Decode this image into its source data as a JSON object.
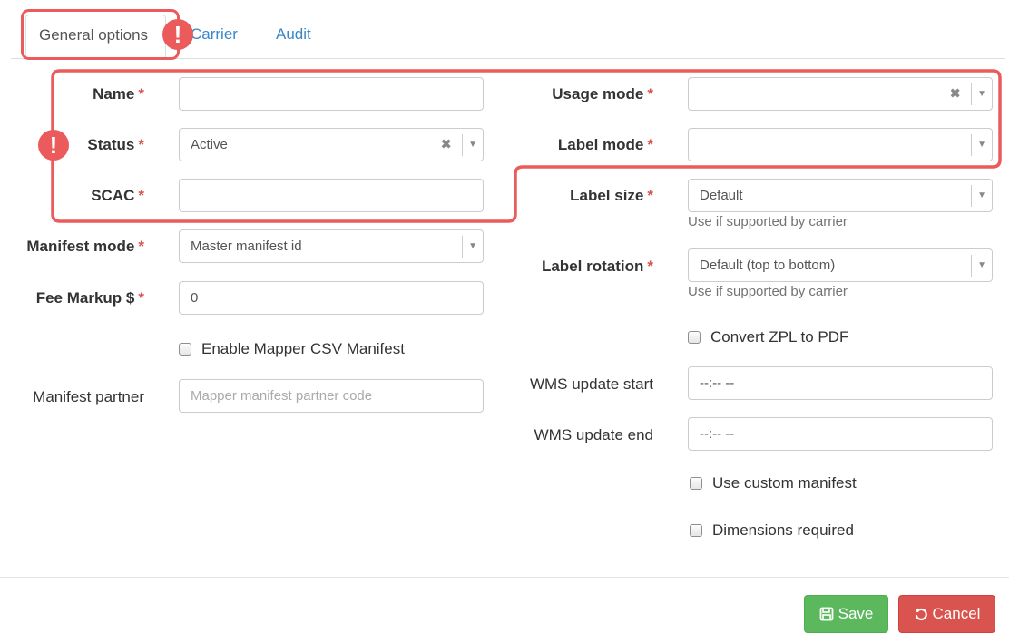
{
  "tabs": {
    "general": "General options",
    "carrier": "Carrier",
    "audit": "Audit"
  },
  "warning_mark": "!",
  "required_mark": "*",
  "left": {
    "name": {
      "label": "Name",
      "value": ""
    },
    "status": {
      "label": "Status",
      "value": "Active"
    },
    "scac": {
      "label": "SCAC",
      "value": ""
    },
    "manifest_mode": {
      "label": "Manifest mode",
      "value": "Master manifest id"
    },
    "fee_markup": {
      "label": "Fee Markup $",
      "value": "0"
    },
    "enable_mapper_csv": {
      "label": "Enable Mapper CSV Manifest",
      "checked": false
    },
    "manifest_partner": {
      "label": "Manifest partner",
      "value": "",
      "placeholder": "Mapper manifest partner code"
    }
  },
  "right": {
    "usage_mode": {
      "label": "Usage mode",
      "value": ""
    },
    "label_mode": {
      "label": "Label mode",
      "value": ""
    },
    "label_size": {
      "label": "Label size",
      "value": "Default",
      "help": "Use if supported by carrier"
    },
    "label_rotation": {
      "label": "Label rotation",
      "value": "Default (top to bottom)",
      "help": "Use if supported by carrier"
    },
    "convert_zpl": {
      "label": "Convert ZPL to PDF",
      "checked": false
    },
    "wms_start": {
      "label": "WMS update start",
      "value": "--:-- --"
    },
    "wms_end": {
      "label": "WMS update end",
      "value": "--:-- --"
    },
    "custom_manifest": {
      "label": "Use custom manifest",
      "checked": false
    },
    "dimensions_required": {
      "label": "Dimensions required",
      "checked": false
    }
  },
  "buttons": {
    "save": "Save",
    "cancel": "Cancel"
  },
  "colors": {
    "highlight": "#ec5b5b",
    "link": "#3a87c8",
    "required": "#d9534f",
    "save": "#5cb85c",
    "cancel": "#d9534f"
  }
}
